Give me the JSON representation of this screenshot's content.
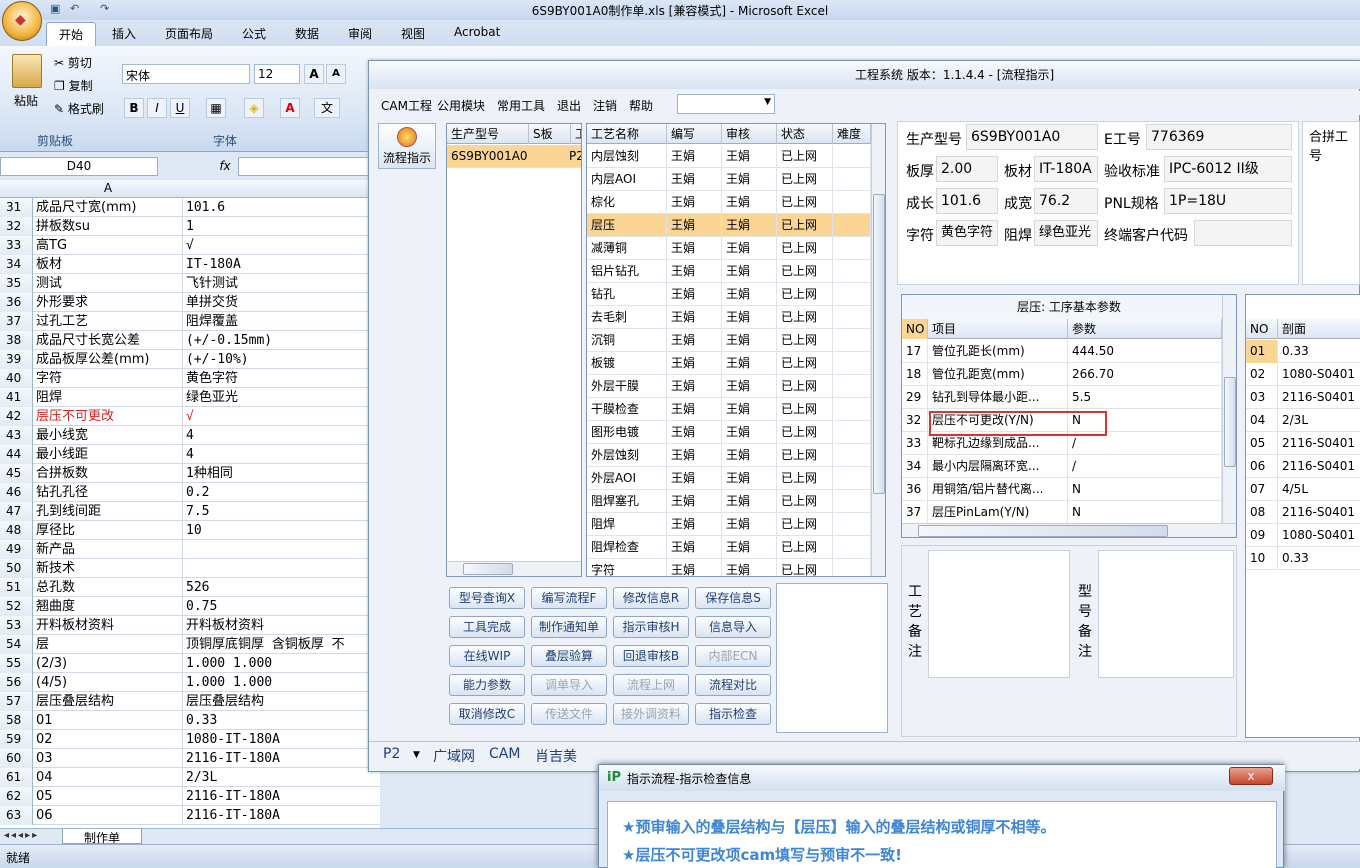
{
  "excel": {
    "window_title": "6S9BY001A0制作单.xls  [兼容模式] - Microsoft Excel",
    "tabs": [
      "开始",
      "插入",
      "页面布局",
      "公式",
      "数据",
      "审阅",
      "视图",
      "Acrobat"
    ],
    "clipboard": {
      "paste": "粘贴",
      "cut": "剪切",
      "copy": "复制",
      "format_painter": "格式刷",
      "group": "剪贴板"
    },
    "font": {
      "name": "宋体",
      "size": "12",
      "group": "字体"
    },
    "name_box": "D40",
    "fx": "fx",
    "column_header": "A",
    "rows": [
      {
        "n": "31",
        "a": "成品尺寸宽(mm)",
        "b": "101.6"
      },
      {
        "n": "32",
        "a": "拼板数su",
        "b": "1"
      },
      {
        "n": "33",
        "a": "高TG",
        "b": "√"
      },
      {
        "n": "34",
        "a": "板材",
        "b": "IT-180A"
      },
      {
        "n": "35",
        "a": "测试",
        "b": "飞针测试"
      },
      {
        "n": "36",
        "a": "外形要求",
        "b": "单拼交货"
      },
      {
        "n": "37",
        "a": "过孔工艺",
        "b": "阻焊覆盖"
      },
      {
        "n": "38",
        "a": "成品尺寸长宽公差",
        "b": "(+/-0.15mm)"
      },
      {
        "n": "39",
        "a": "成品板厚公差(mm)",
        "b": "(+/-10%)"
      },
      {
        "n": "40",
        "a": "字符",
        "b": "黄色字符"
      },
      {
        "n": "41",
        "a": "阻焊",
        "b": "绿色亚光"
      },
      {
        "n": "42",
        "a": "层压不可更改",
        "b": "√",
        "red": true
      },
      {
        "n": "43",
        "a": "最小线宽",
        "b": "4"
      },
      {
        "n": "44",
        "a": "最小线距",
        "b": "4"
      },
      {
        "n": "45",
        "a": "合拼板数",
        "b": "1种相同"
      },
      {
        "n": "46",
        "a": "钻孔孔径",
        "b": "0.2"
      },
      {
        "n": "47",
        "a": "孔到线间距",
        "b": "7.5"
      },
      {
        "n": "48",
        "a": "厚径比",
        "b": "10"
      },
      {
        "n": "49",
        "a": "新产品",
        "b": ""
      },
      {
        "n": "50",
        "a": "新技术",
        "b": ""
      },
      {
        "n": "51",
        "a": "总孔数",
        "b": "526"
      },
      {
        "n": "52",
        "a": "翘曲度",
        "b": "0.75"
      },
      {
        "n": "53",
        "a": "开料板材资料",
        "b": "开料板材资料"
      },
      {
        "n": "54",
        "a": "层",
        "b": "顶铜厚底铜厚 含铜板厚 不"
      },
      {
        "n": "55",
        "a": "(2/3)",
        "b": "1.000  1.000"
      },
      {
        "n": "56",
        "a": "(4/5)",
        "b": "1.000  1.000"
      },
      {
        "n": "57",
        "a": "层压叠层结构",
        "b": "层压叠层结构"
      },
      {
        "n": "58",
        "a": "01",
        "b": "0.33"
      },
      {
        "n": "59",
        "a": "02",
        "b": "1080-IT-180A"
      },
      {
        "n": "60",
        "a": "03",
        "b": "2116-IT-180A"
      },
      {
        "n": "61",
        "a": "04",
        "b": "2/3L"
      },
      {
        "n": "62",
        "a": "05",
        "b": "2116-IT-180A"
      },
      {
        "n": "63",
        "a": "06",
        "b": "2116-IT-180A"
      }
    ],
    "sheet_tab": "制作单",
    "status": "就绪"
  },
  "eng": {
    "title": "工程系统  版本：1.1.4.4 - [流程指示]",
    "menu": [
      "CAM工程",
      "公用模块",
      "常用工具",
      "退出",
      "注销",
      "帮助"
    ],
    "flow_button": "流程指示",
    "model_table": {
      "headers": [
        "生产型号",
        "S板",
        "工"
      ],
      "rows": [
        [
          "6S9BY001A0",
          "",
          "P2"
        ]
      ]
    },
    "process_table": {
      "headers": [
        "工艺名称",
        "编写",
        "审核",
        "状态",
        "难度"
      ],
      "rows": [
        [
          "内层蚀刻",
          "王娟",
          "王娟",
          "已上网",
          ""
        ],
        [
          "内层AOI",
          "王娟",
          "王娟",
          "已上网",
          ""
        ],
        [
          "棕化",
          "王娟",
          "王娟",
          "已上网",
          ""
        ],
        [
          "层压",
          "王娟",
          "王娟",
          "已上网",
          ""
        ],
        [
          "减薄铜",
          "王娟",
          "王娟",
          "已上网",
          ""
        ],
        [
          "铝片钻孔",
          "王娟",
          "王娟",
          "已上网",
          ""
        ],
        [
          "钻孔",
          "王娟",
          "王娟",
          "已上网",
          ""
        ],
        [
          "去毛刺",
          "王娟",
          "王娟",
          "已上网",
          ""
        ],
        [
          "沉铜",
          "王娟",
          "王娟",
          "已上网",
          ""
        ],
        [
          "板镀",
          "王娟",
          "王娟",
          "已上网",
          ""
        ],
        [
          "外层干膜",
          "王娟",
          "王娟",
          "已上网",
          ""
        ],
        [
          "干膜检查",
          "王娟",
          "王娟",
          "已上网",
          ""
        ],
        [
          "图形电镀",
          "王娟",
          "王娟",
          "已上网",
          ""
        ],
        [
          "外层蚀刻",
          "王娟",
          "王娟",
          "已上网",
          ""
        ],
        [
          "外层AOI",
          "王娟",
          "王娟",
          "已上网",
          ""
        ],
        [
          "阻焊塞孔",
          "王娟",
          "王娟",
          "已上网",
          ""
        ],
        [
          "阻焊",
          "王娟",
          "王娟",
          "已上网",
          ""
        ],
        [
          "阻焊检查",
          "王娟",
          "王娟",
          "已上网",
          ""
        ],
        [
          "字符",
          "王娟",
          "王娟",
          "已上网",
          ""
        ]
      ],
      "selected_index": 3
    },
    "buttons": [
      {
        "label": "型号查询X",
        "enabled": true
      },
      {
        "label": "编写流程F",
        "enabled": true
      },
      {
        "label": "修改信息R",
        "enabled": true
      },
      {
        "label": "保存信息S",
        "enabled": true
      },
      {
        "label": "工具完成",
        "enabled": true
      },
      {
        "label": "制作通知单",
        "enabled": true
      },
      {
        "label": "指示审核H",
        "enabled": true
      },
      {
        "label": "信息导入",
        "enabled": true
      },
      {
        "label": "在线WIP",
        "enabled": true
      },
      {
        "label": "叠层验算",
        "enabled": true
      },
      {
        "label": "回退审核B",
        "enabled": true
      },
      {
        "label": "内部ECN",
        "enabled": false
      },
      {
        "label": "能力参数",
        "enabled": true
      },
      {
        "label": "调单导入",
        "enabled": false
      },
      {
        "label": "流程上网",
        "enabled": false
      },
      {
        "label": "流程对比",
        "enabled": true
      },
      {
        "label": "取消修改C",
        "enabled": true
      },
      {
        "label": "传送文件",
        "enabled": false
      },
      {
        "label": "接外调资料",
        "enabled": false
      },
      {
        "label": "指示检查",
        "enabled": true
      }
    ],
    "info": {
      "model_label": "生产型号",
      "model_value": "6S9BY001A0",
      "e_label": "E工号",
      "e_value": "776369",
      "thick_label": "板厚",
      "thick_value": "2.00",
      "mat_label": "板材",
      "mat_value": "IT-180A",
      "std_label": "验收标准",
      "std_value": "IPC-6012 II级",
      "len_label": "成长",
      "len_value": "101.6",
      "wid_label": "成宽",
      "wid_value": "76.2",
      "pnl_label": "PNL规格",
      "pnl_value": "1P=18U",
      "char_label": "字符",
      "char_value": "黄色字符",
      "mask_label": "阻焊",
      "mask_value": "绿色亚光",
      "cust_label": "终端客户代码",
      "cust_value": "",
      "merge_label": "合拼工号"
    },
    "param_table": {
      "title": "层压: 工序基本参数",
      "headers": [
        "NO",
        "项目",
        "参数"
      ],
      "rows": [
        [
          "17",
          "管位孔距长(mm)",
          "444.50"
        ],
        [
          "18",
          "管位孔距宽(mm)",
          "266.70"
        ],
        [
          "29",
          "钻孔到导体最小距...",
          "5.5"
        ],
        [
          "32",
          "层压不可更改(Y/N)",
          "N"
        ],
        [
          "33",
          "靶标孔边缘到成品...",
          "/"
        ],
        [
          "34",
          "最小内层隔离环宽...",
          "/"
        ],
        [
          "36",
          "用铜箔/铝片替代离...",
          "N"
        ],
        [
          "37",
          "层压PinLam(Y/N)",
          "N"
        ]
      ],
      "highlight_index": 3
    },
    "stack_table": {
      "headers": [
        "NO",
        "剖面"
      ],
      "rows": [
        [
          "01",
          "0.33"
        ],
        [
          "02",
          "1080-S0401"
        ],
        [
          "03",
          "2116-S0401"
        ],
        [
          "04",
          "2/3L"
        ],
        [
          "05",
          "2116-S0401"
        ],
        [
          "06",
          "2116-S0401"
        ],
        [
          "07",
          "4/5L"
        ],
        [
          "08",
          "2116-S0401"
        ],
        [
          "09",
          "1080-S0401"
        ],
        [
          "10",
          "0.33"
        ]
      ]
    },
    "remarks": {
      "process_label": "工艺备注",
      "model_label": "型号备注"
    },
    "bottom": {
      "page": "P2",
      "tabs": [
        "广域网",
        "CAM",
        "肖吉美"
      ]
    }
  },
  "popup": {
    "title": "指示流程-指示检查信息",
    "close": "x",
    "messages": [
      "★预审输入的叠层结构与【层压】输入的叠层结构或铜厚不相等。",
      "★层压不可更改项cam填写与预审不一致!"
    ]
  }
}
